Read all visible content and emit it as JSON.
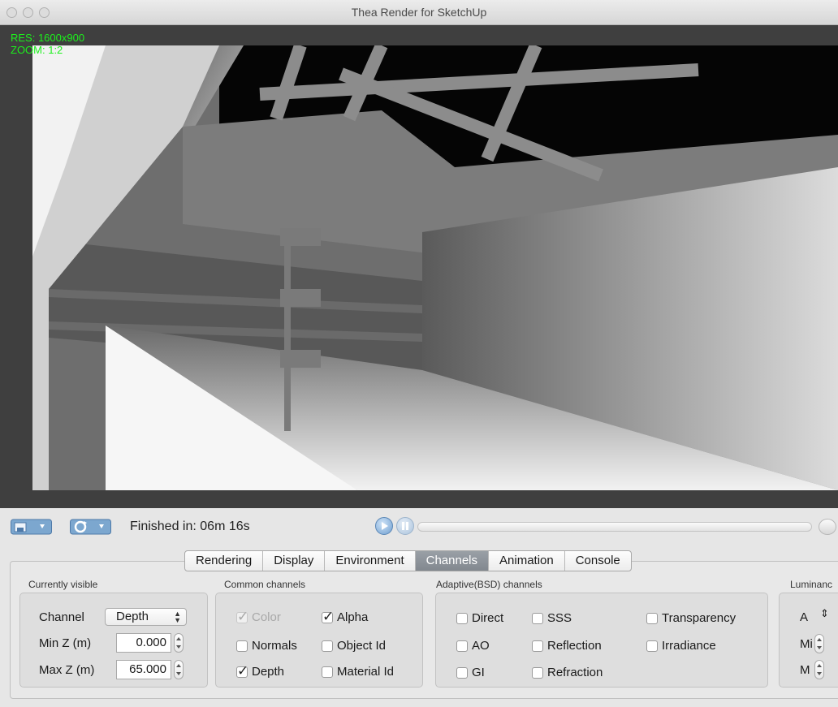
{
  "window": {
    "title": "Thea Render for SketchUp"
  },
  "overlay": {
    "res": "RES: 1600x900",
    "zoom": "ZOOM: 1:2"
  },
  "toolbar": {
    "status": "Finished in: 06m 16s"
  },
  "tabs": [
    {
      "label": "Rendering",
      "active": false
    },
    {
      "label": "Display",
      "active": false
    },
    {
      "label": "Environment",
      "active": false
    },
    {
      "label": "Channels",
      "active": true
    },
    {
      "label": "Animation",
      "active": false
    },
    {
      "label": "Console",
      "active": false
    }
  ],
  "currently_visible": {
    "group_label": "Currently visible",
    "channel_label": "Channel",
    "channel_value": "Depth",
    "minz_label": "Min Z (m)",
    "minz_value": "0.000",
    "maxz_label": "Max Z (m)",
    "maxz_value": "65.000"
  },
  "common_channels": {
    "group_label": "Common channels",
    "items": [
      {
        "label": "Color",
        "checked": true,
        "disabled": true
      },
      {
        "label": "Alpha",
        "checked": true,
        "disabled": false
      },
      {
        "label": "Normals",
        "checked": false,
        "disabled": false
      },
      {
        "label": "Object Id",
        "checked": false,
        "disabled": false
      },
      {
        "label": "Depth",
        "checked": true,
        "disabled": false
      },
      {
        "label": "Material Id",
        "checked": false,
        "disabled": false
      }
    ]
  },
  "adaptive_channels": {
    "group_label": "Adaptive(BSD) channels",
    "items": [
      {
        "label": "Direct",
        "checked": false
      },
      {
        "label": "SSS",
        "checked": false
      },
      {
        "label": "Transparency",
        "checked": false
      },
      {
        "label": "AO",
        "checked": false
      },
      {
        "label": "Reflection",
        "checked": false
      },
      {
        "label": "Irradiance",
        "checked": false
      },
      {
        "label": "GI",
        "checked": false
      },
      {
        "label": "Refraction",
        "checked": false
      }
    ]
  },
  "luminance": {
    "group_label": "Luminanc",
    "row1": "A",
    "row2": "Mi",
    "row3": "M"
  }
}
